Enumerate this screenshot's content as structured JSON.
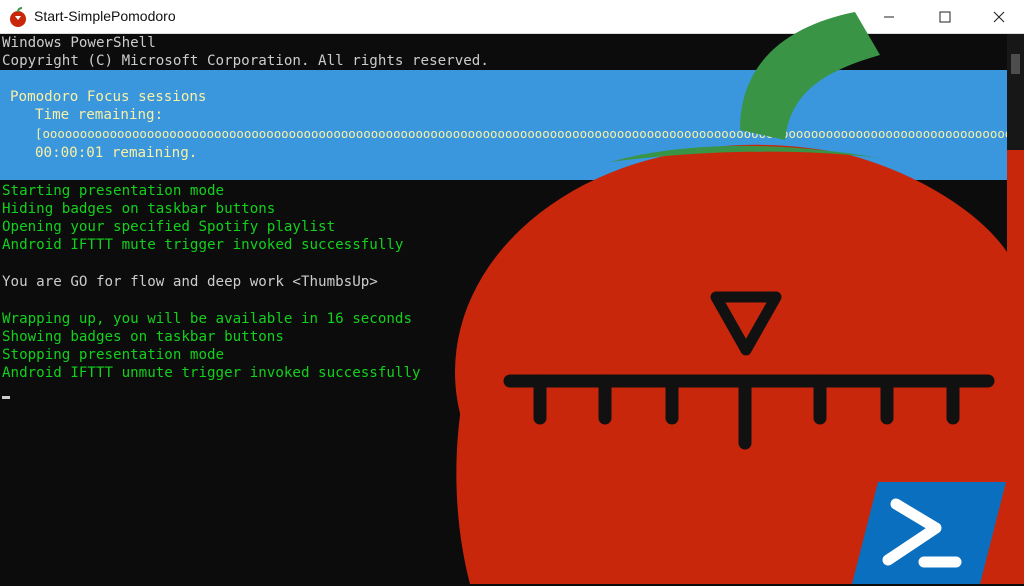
{
  "window": {
    "title": "Start-SimplePomodoro",
    "app_icon": "tomato-icon",
    "controls": [
      "minimize-icon",
      "maximize-icon",
      "close-icon"
    ]
  },
  "console": {
    "header_lines": [
      "Windows PowerShell",
      "Copyright (C) Microsoft Corporation. All rights reserved."
    ],
    "progress": {
      "activity": "Pomodoro Focus sessions",
      "status": "Time remaining:",
      "bar": "[oooooooooooooooooooooooooooooooooooooooooooooooooooooooooooooooooooooooooooooooooooooooooooooooooooooooooooooooooooooooooooooooooooo    ]",
      "remaining": "00:00:01 remaining.",
      "percent_complete": 97
    },
    "output_lines": [
      "Starting presentation mode",
      "Hiding badges on taskbar buttons",
      "Opening your specified Spotify playlist",
      "Android IFTTT mute trigger invoked successfully",
      "",
      "You are GO for flow and deep work <ThumbsUp>",
      "",
      "Wrapping up, you will be available in 16 seconds",
      "Showing badges on taskbar buttons",
      "Stopping presentation mode",
      "Android IFTTT unmute trigger invoked successfully"
    ]
  },
  "colors": {
    "console_background": "#0c0c0c",
    "console_text": "#cccccc",
    "output_text": "#13d01d",
    "progress_background": "#3a96dd",
    "progress_text": "#f9f1a5",
    "tomato_red": "#c9270b",
    "stem_green": "#3a9446",
    "powershell_blue": "#0a6fbf"
  },
  "overlay": {
    "tomato_icon": "tomato-timer-icon",
    "powershell_icon": "powershell-logo-icon"
  }
}
